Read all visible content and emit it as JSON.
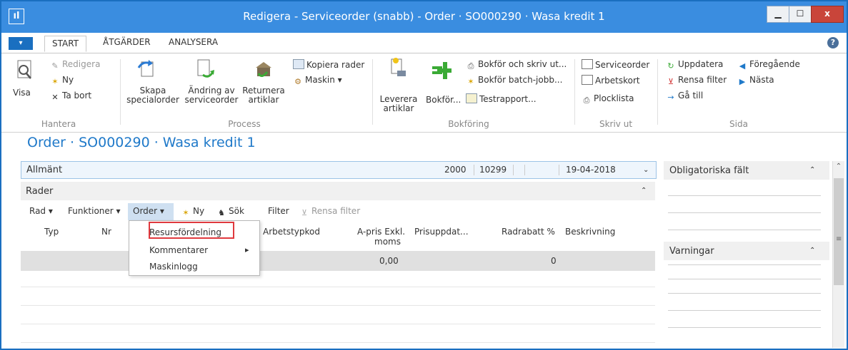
{
  "window": {
    "title": "Redigera - Serviceorder (snabb) - Order · SO000290 · Wasa kredit 1",
    "minimize": "▁",
    "maximize": "☐",
    "close": "x"
  },
  "tabs": {
    "file": "▾",
    "start": "START",
    "actions": "ÅTGÄRDER",
    "analyze": "ANALYSERA",
    "help": "?"
  },
  "ribbon": {
    "manage": {
      "view": "Visa",
      "edit": "Redigera",
      "new": "Ny",
      "delete": "Ta bort",
      "label": "Hantera"
    },
    "process": {
      "create_special_line1": "Skapa",
      "create_special_line2": "specialorder",
      "change_line1": "Ändring av",
      "change_line2": "serviceorder",
      "return_line1": "Returnera",
      "return_line2": "artiklar",
      "copy_rows": "Kopiera rader",
      "machine": "Maskin ▾",
      "label": "Process"
    },
    "posting": {
      "deliver_line1": "Leverera",
      "deliver_line2": "artiklar",
      "post": "Bokför...",
      "post_print": "Bokför och skriv ut...",
      "post_batch": "Bokför batch-jobb...",
      "test_report": "Testrapport...",
      "label": "Bokföring"
    },
    "print": {
      "service_order": "Serviceorder",
      "work_card": "Arbetskort",
      "pick_list": "Plocklista",
      "label": "Skriv ut"
    },
    "page": {
      "refresh": "Uppdatera",
      "clear_filter": "Rensa filter",
      "goto": "Gå till",
      "previous": "Föregående",
      "next": "Nästa",
      "label": "Sida"
    }
  },
  "page_title": "Order · SO000290 · Wasa kredit 1",
  "general": {
    "label": "Allmänt",
    "v1": "2000",
    "v2": "10299",
    "date": "19-04-2018"
  },
  "lines": {
    "label": "Rader",
    "toolbar": {
      "row": "Rad ▾",
      "functions": "Funktioner ▾",
      "order": "Order ▾",
      "new": "Ny",
      "search": "Sök",
      "filter": "Filter",
      "clear_filter": "Rensa filter"
    },
    "columns": {
      "type": "Typ",
      "no": "Nr",
      "work_type": "Arbetstypkod",
      "price1": "A-pris Exkl.",
      "price2": "moms",
      "price_update": "Prisuppdat...",
      "line_discount": "Radrabatt %",
      "description": "Beskrivning"
    },
    "row": {
      "price": "0,00",
      "discount": "0"
    }
  },
  "order_menu": {
    "item1": "Resursfördelning",
    "item2": "Kommentarer",
    "item3": "Maskinlogg",
    "submenu_arrow": "▸"
  },
  "factbox": {
    "required": "Obligatoriska fält",
    "warnings": "Varningar"
  }
}
